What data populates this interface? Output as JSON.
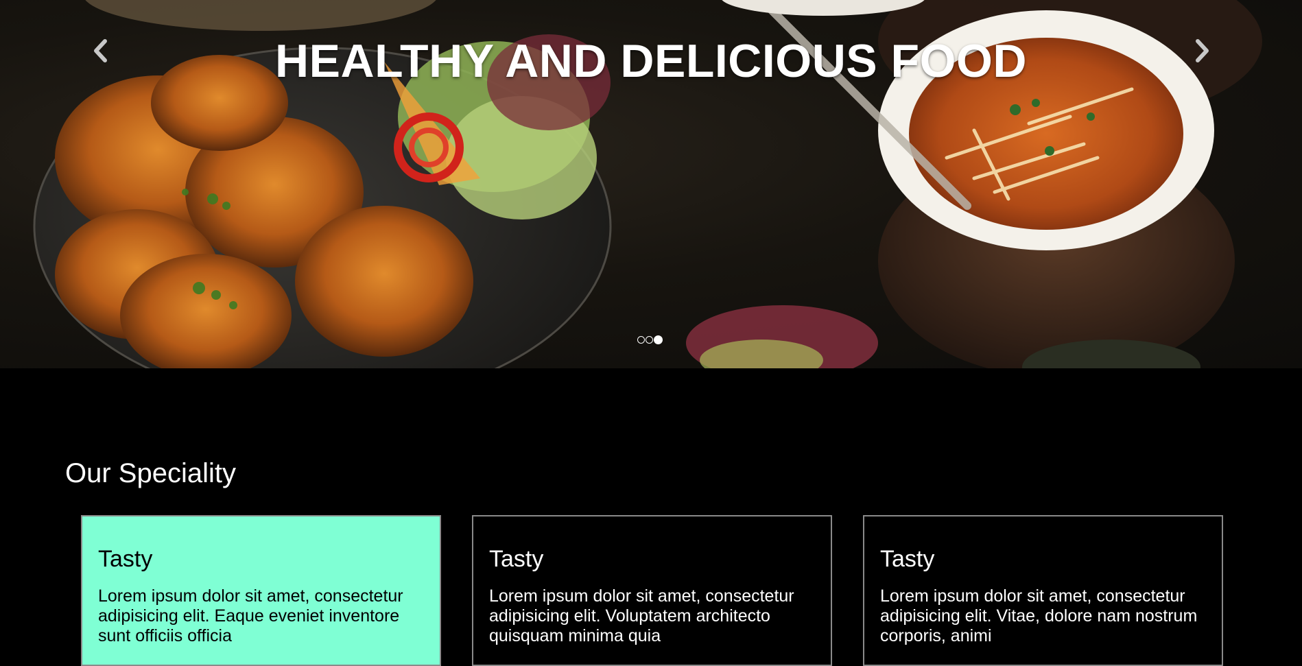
{
  "hero": {
    "title": "HEALTHY AND DELICIOUS FOOD",
    "prev_icon": "chevron-left-icon",
    "next_icon": "chevron-right-icon",
    "slide_count": 3,
    "active_slide": 3
  },
  "speciality": {
    "heading": "Our Speciality",
    "cards": [
      {
        "title": "Tasty",
        "text": "Lorem ipsum dolor sit amet, consectetur adipisicing elit. Eaque eveniet inventore sunt officiis officia",
        "background": "#7fffd4"
      },
      {
        "title": "Tasty",
        "text": "Lorem ipsum dolor sit amet, consectetur adipisicing elit. Voluptatem architecto quisquam minima quia"
      },
      {
        "title": "Tasty",
        "text": "Lorem ipsum dolor sit amet, consectetur adipisicing elit. Vitae, dolore nam nostrum corporis, animi"
      }
    ]
  },
  "colors": {
    "page_background": "#000000",
    "highlight_card": "#7fffd4",
    "card_border": "#8a8a8a",
    "text_light": "#ffffff"
  }
}
